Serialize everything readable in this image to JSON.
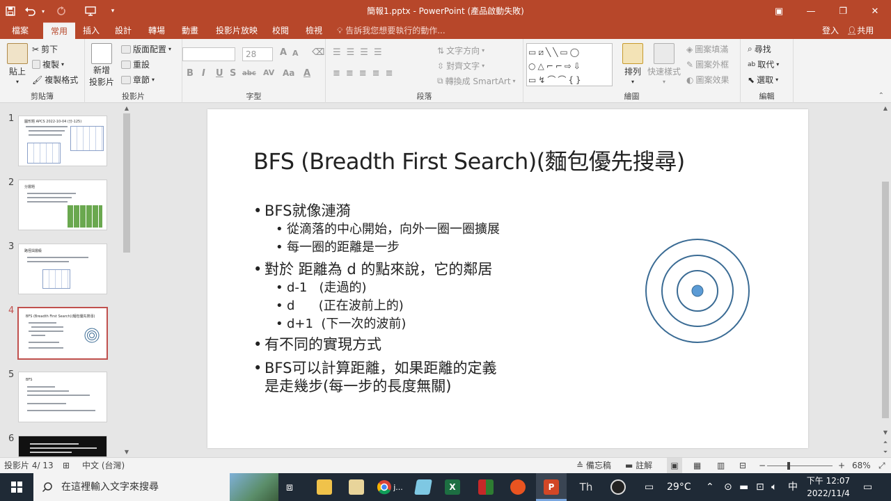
{
  "window": {
    "title": "簡報1.pptx - PowerPoint (產品啟動失敗)",
    "minimize_glyph": "—",
    "restore_glyph": "❐",
    "close_glyph": "✕",
    "ribbon_display_glyph": "▣",
    "accent_color": "#b7472a"
  },
  "qat": {
    "save_icon": "save-icon",
    "undo_icon": "undo-icon",
    "redo_icon": "redo-icon",
    "present_icon": "start-from-beginning-icon",
    "customize_icon": "chevron-down-icon"
  },
  "tabs": [
    "檔案",
    "常用",
    "插入",
    "設計",
    "轉場",
    "動畫",
    "投影片放映",
    "校閱",
    "檢視"
  ],
  "active_tab": "常用",
  "tell_me": "告訴我您想要執行的動作...",
  "sign_in": "登入",
  "share": "共用",
  "ribbon": {
    "clipboard": {
      "paste": "貼上",
      "cut": "剪下",
      "copy": "複製",
      "format_painter": "複製格式",
      "label": "剪貼簿"
    },
    "slides": {
      "new_slide_line1": "新增",
      "new_slide_line2": "投影片",
      "layout": "版面配置",
      "reset": "重設",
      "section": "章節",
      "label": "投影片"
    },
    "font": {
      "font_size": "28",
      "bold": "B",
      "italic": "I",
      "underline": "U",
      "strike": "S",
      "spacing": "abc",
      "case": "Aa",
      "label": "字型"
    },
    "paragraph": {
      "text_direction": "文字方向",
      "align_text": "對齊文字",
      "smartart": "轉換成 SmartArt",
      "label": "段落"
    },
    "drawing": {
      "arrange": "排列",
      "quick_styles": "快速樣式",
      "shape_fill": "圖案填滿",
      "shape_outline": "圖案外框",
      "shape_effects": "圖案效果",
      "label": "繪圖"
    },
    "editing": {
      "find": "尋找",
      "replace": "取代",
      "select": "選取",
      "label": "編輯"
    }
  },
  "thumbnails": [
    {
      "number": "1",
      "title": "圖形題 APCS 2022-10-04 (分-125)"
    },
    {
      "number": "2",
      "title": "分層題"
    },
    {
      "number": "3",
      "title": "路徑與層級"
    },
    {
      "number": "4",
      "title": "BFS (Breadth First Search)(麵包優先搜尋)"
    },
    {
      "number": "5",
      "title": "BFS"
    },
    {
      "number": "6",
      "title": ""
    }
  ],
  "slide": {
    "title": "BFS (Breadth First Search)(麵包優先搜尋)",
    "bullets": [
      {
        "level": 1,
        "text": "BFS就像漣漪"
      },
      {
        "level": 2,
        "text": "從滴落的中心開始，向外一圈一圈擴展"
      },
      {
        "level": 2,
        "text": "每一圈的距離是一步"
      },
      {
        "level": 1,
        "text": "對於 距離為 d 的點來說，它的鄰居"
      },
      {
        "level": 2,
        "text": "d-1   (走過的)"
      },
      {
        "level": 2,
        "text": "d      (正在波前上的)"
      },
      {
        "level": 2,
        "text": "d+1  (下一次的波前)"
      },
      {
        "level": 1,
        "text": "有不同的實現方式"
      },
      {
        "level": 1,
        "text": "BFS可以計算距離，如果距離的定義"
      },
      {
        "level": 0,
        "text": "是走幾步(每一步的長度無關)"
      }
    ],
    "bullet_glyph": "•",
    "ripple_color": "#3a6b94",
    "ripple_center_color": "#5b9bd5"
  },
  "status": {
    "slide_counter": "投影片 4/ 13",
    "language": "中文 (台灣)",
    "notes": "備忘稿",
    "comments": "註解",
    "zoom_minus": "−",
    "zoom_plus": "+",
    "zoom": "68%"
  },
  "taskbar": {
    "search_placeholder": "在這裡輸入文字來搜尋",
    "temperature": "29°C",
    "ime": "中",
    "time": "下午 12:07",
    "date": "2022/11/4",
    "chrome_label": "j..."
  }
}
